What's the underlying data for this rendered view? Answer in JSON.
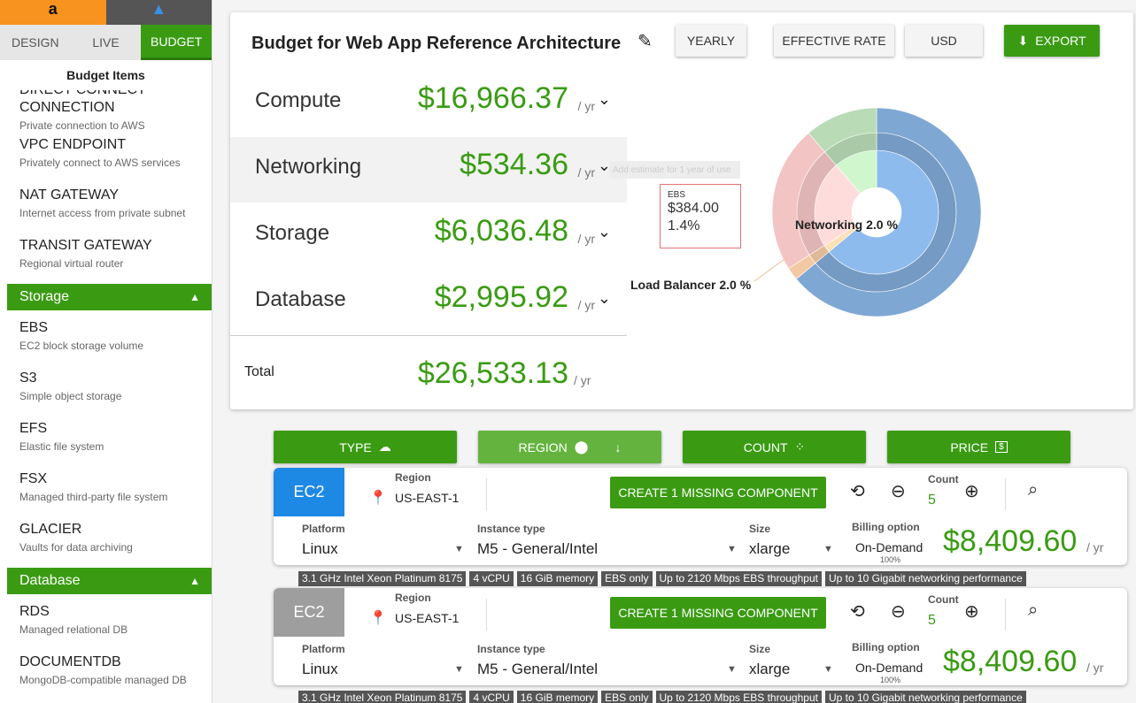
{
  "cloud_tabs": {
    "aws_glyph": "a",
    "azure_glyph": "▲"
  },
  "mode_tabs": [
    "DESIGN",
    "LIVE",
    "BUDGET"
  ],
  "sidebar": {
    "title": "Budget Items",
    "networking_items": [
      {
        "title": "Direct Connect Connection",
        "desc": "Private connection to AWS"
      },
      {
        "title": "VPC Endpoint",
        "desc": "Privately connect to AWS services"
      },
      {
        "title": "NAT Gateway",
        "desc": "Internet access from private subnet"
      },
      {
        "title": "Transit Gateway",
        "desc": "Regional virtual router"
      }
    ],
    "storage_header": "Storage",
    "storage_items": [
      {
        "title": "EBS",
        "desc": "EC2 block storage volume"
      },
      {
        "title": "S3",
        "desc": "Simple object storage"
      },
      {
        "title": "EFS",
        "desc": "Elastic file system"
      },
      {
        "title": "FSX",
        "desc": "Managed third-party file system"
      },
      {
        "title": "Glacier",
        "desc": "Vaults for data archiving"
      }
    ],
    "database_header": "Database",
    "database_items": [
      {
        "title": "RDS",
        "desc": "Managed relational DB"
      },
      {
        "title": "DocumentDB",
        "desc": "MongoDB-compatible managed DB"
      }
    ]
  },
  "budget": {
    "title": "Budget for Web App Reference Architecture",
    "buttons": {
      "yearly": "YEARLY",
      "effective_rate": "EFFECTIVE RATE",
      "currency": "USD",
      "export": "EXPORT"
    },
    "rows": [
      {
        "label": "Compute",
        "value": "$16,966.37",
        "unit": "/ yr"
      },
      {
        "label": "Networking",
        "value": "$534.36",
        "unit": "/ yr"
      },
      {
        "label": "Storage",
        "value": "$6,036.48",
        "unit": "/ yr"
      },
      {
        "label": "Database",
        "value": "$2,995.92",
        "unit": "/ yr"
      }
    ],
    "total": {
      "label": "Total",
      "value": "$26,533.13",
      "unit": "/ yr"
    },
    "tooltip_faded": "Add estimate for 1 year of use",
    "ebs_tooltip": {
      "name": "EBS",
      "value": "$384.00",
      "pct": "1.4%"
    },
    "chart_labels": {
      "networking": "Networking 2.0 %",
      "load_balancer": "Load Balancer 2.0 %"
    }
  },
  "chart_data": {
    "type": "pie",
    "title": "",
    "slices": [
      {
        "label": "Compute",
        "value": 16966.37,
        "color": "#7fa7d4"
      },
      {
        "label": "Networking",
        "value": 534.36,
        "color": "#f3c9a3"
      },
      {
        "label": "Storage",
        "value": 6036.48,
        "color": "#f2c4c4"
      },
      {
        "label": "Database",
        "value": 2995.92,
        "color": "#b9dcb6"
      }
    ]
  },
  "filters": [
    {
      "label": "TYPE",
      "icon": "cloud-icon"
    },
    {
      "label": "REGION",
      "icon": "location-pin-icon"
    },
    {
      "label": "COUNT",
      "icon": "scatter-icon"
    },
    {
      "label": "PRICE",
      "icon": "dollar-bill-icon"
    }
  ],
  "instances": [
    {
      "badge": "EC2",
      "badge_color": "#1e88e5",
      "region_label": "Region",
      "region": "US-EAST-1",
      "missing": "CREATE 1 MISSING COMPONENT",
      "count_label": "Count",
      "count": "5",
      "platform_label": "Platform",
      "platform": "Linux",
      "instance_label": "Instance type",
      "instance": "M5 - General/Intel",
      "size_label": "Size",
      "size": "xlarge",
      "billing_label": "Billing option",
      "billing": "On-Demand",
      "billing_pct": "100%",
      "price": "$8,409.60",
      "unit": "/ yr",
      "specs": [
        "3.1 GHz Intel Xeon Platinum 8175",
        "4 vCPU",
        "16 GiB memory",
        "EBS only",
        "Up to 2120 Mbps EBS throughput",
        "Up to 10 Gigabit networking performance"
      ]
    },
    {
      "badge": "EC2",
      "badge_color": "#9e9e9e",
      "region_label": "Region",
      "region": "US-EAST-1",
      "missing": "CREATE 1 MISSING COMPONENT",
      "count_label": "Count",
      "count": "5",
      "platform_label": "Platform",
      "platform": "Linux",
      "instance_label": "Instance type",
      "instance": "M5 - General/Intel",
      "size_label": "Size",
      "size": "xlarge",
      "billing_label": "Billing option",
      "billing": "On-Demand",
      "billing_pct": "100%",
      "price": "$8,409.60",
      "unit": "/ yr",
      "specs": [
        "3.1 GHz Intel Xeon Platinum 8175",
        "4 vCPU",
        "16 GiB memory",
        "EBS only",
        "Up to 2120 Mbps EBS throughput",
        "Up to 10 Gigabit networking performance"
      ]
    }
  ]
}
